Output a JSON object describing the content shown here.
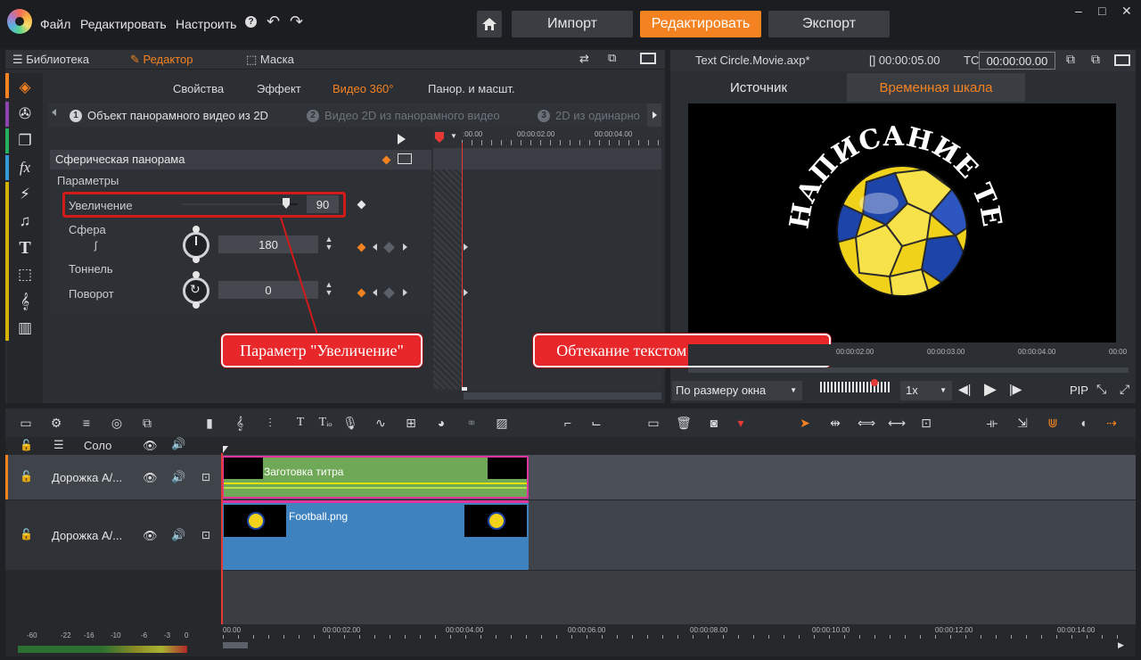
{
  "menu": {
    "file": "Файл",
    "edit": "Редактировать",
    "settings": "Настроить"
  },
  "modes": {
    "import": "Импорт",
    "edit": "Редактировать",
    "export": "Экспорт"
  },
  "window": {
    "minimize": "–",
    "restore": "□",
    "close": "✕"
  },
  "left_tabs": {
    "library": "Библиотека",
    "editor": "Редактор",
    "mask": "Маска"
  },
  "prop_tabs": [
    "Свойства",
    "Эффект",
    "Видео 360°",
    "Панор. и масшт."
  ],
  "steps": [
    {
      "num": "1",
      "label": "Объект панорамного видео из 2D"
    },
    {
      "num": "2",
      "label": "Видео 2D из панорамного видео"
    },
    {
      "num": "3",
      "label": "2D из одинарно"
    }
  ],
  "params": {
    "section": "Сферическая панорама",
    "group": "Параметры",
    "zoom_label": "Увеличение",
    "zoom_value": "90",
    "zoom_level": 0.9,
    "sphere_label": "Сфера",
    "sphere_value": "180",
    "tunnel_label": "Тоннель",
    "rotate_label": "Поворот",
    "rotate_value": "0"
  },
  "kf_ruler": [
    ":00.00",
    "00:00:02.00",
    "00:00:04.00"
  ],
  "callouts": {
    "zoom": "Параметр \"Увеличение\"",
    "wrap": "Обтекание текстом круглого объекта"
  },
  "preview": {
    "file_title": "Text Circle.Movie.axp*",
    "duration": "[] 00:00:05.00",
    "tc_label": "TC",
    "tc_value": "00:00:00.00",
    "tab_source": "Источник",
    "tab_timeline": "Временная шкала",
    "curved_text": "НАПИСАНИЕ ТЕКСТА ПО КРУГУ",
    "ruler": [
      "00:00:02.00",
      "00:00:03.00",
      "00:00:04.00",
      "00:00"
    ],
    "fit": "По размеру окна",
    "speed": "1x",
    "pip": "PIP"
  },
  "tracks": {
    "solo_label": "Соло",
    "track1_name": "Дорожка А/...",
    "track2_name": "Дорожка А/...",
    "clip1": "Заготовка титра",
    "clip2": "Football.png"
  },
  "tl_ruler": [
    "00.00",
    "00:00:02.00",
    "00:00:04.00",
    "00:00:06.00",
    "00:00:08.00",
    "00:00:10.00",
    "00:00:12.00",
    "00:00:14.00"
  ],
  "meter_scale": [
    "-60",
    "-22",
    "-16",
    "-10",
    "-6",
    "-3",
    "0"
  ],
  "colors": {
    "accent": "#f58220",
    "callout": "#e8272b",
    "clip_title": "#6fa857",
    "clip_image": "#3e82bf",
    "clip_border": "#e0359f"
  }
}
